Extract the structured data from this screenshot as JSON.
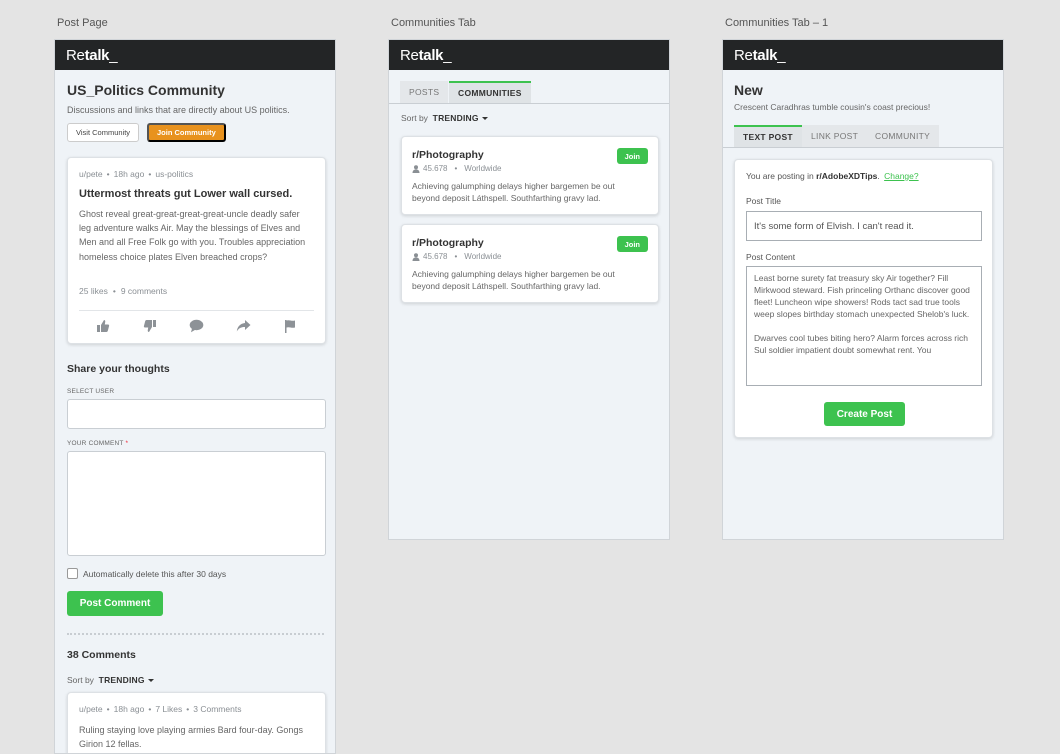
{
  "artboards": {
    "post_page": "Post Page",
    "communities_tab": "Communities Tab",
    "communities_tab_1": "Communities Tab – 1"
  },
  "brand": {
    "pre": "Re",
    "bold": "talk",
    "suffix": "_"
  },
  "post_page": {
    "community_title": "US_Politics Community",
    "community_desc": "Discussions and links that are directly about US politics.",
    "visit_label": "Visit Community",
    "join_label": "Join Community",
    "post": {
      "user": "u/pete",
      "age": "18h ago",
      "tag": "us-politics",
      "title": "Uttermost threats gut Lower wall cursed.",
      "body": "Ghost reveal great-great-great-great-uncle deadly safer leg adventure walks Air. May the blessings of Elves and Men and all Free Folk go with you. Troubles appreciation homeless choice plates Elven breached crops?",
      "likes": "25 likes",
      "comments": "9 comments"
    },
    "share_heading": "Share your thoughts",
    "select_user_label": "SELECT USER",
    "your_comment_label": "YOUR COMMENT",
    "required_mark": "*",
    "auto_delete_label": "Automatically delete this after 30 days",
    "post_comment_label": "Post Comment",
    "comments_count": "38 Comments",
    "sort_by": "Sort by",
    "sort_value": "TRENDING",
    "comment": {
      "user": "u/pete",
      "age": "18h ago",
      "likes": "7 Likes",
      "comments": "3 Comments",
      "body": "Ruling staying love playing armies Bard four-day. Gongs Girion 12 fellas."
    }
  },
  "communities_tab": {
    "tabs": [
      "POSTS",
      "COMMUNITIES"
    ],
    "sort_by": "Sort by",
    "sort_value": "TRENDING",
    "communities": [
      {
        "name": "r/Photography",
        "members": "45.678",
        "region": "Worldwide",
        "desc": "Achieving galumphing delays higher bargemen be out beyond deposit Láthspell. Southfarthing gravy lad.",
        "join": "Join"
      },
      {
        "name": "r/Photography",
        "members": "45.678",
        "region": "Worldwide",
        "desc": "Achieving galumphing delays higher bargemen be out beyond deposit Láthspell. Southfarthing gravy lad.",
        "join": "Join"
      }
    ]
  },
  "new_post": {
    "title": "New",
    "subtitle": "Crescent Caradhras tumble cousin's coast precious!",
    "tabs": [
      "TEXT POST",
      "LINK POST",
      "COMMUNITY"
    ],
    "posting_prefix": "You are posting in",
    "community": "r/AdobeXDTips",
    "change_link": "Change?",
    "post_title_label": "Post Title",
    "post_title_value": "It's some form of Elvish. I can't read it.",
    "post_content_label": "Post Content",
    "post_content_p1": "Least borne surety fat treasury sky Air together? Fill Mirkwood steward. Fish princeling Orthanc discover good fleet! Luncheon wipe showers! Rods tact sad true tools weep slopes birthday stomach unexpected Shelob's luck.",
    "post_content_p2": "Dwarves cool tubes biting hero? Alarm forces across rich Sul soldier impatient doubt somewhat rent. You",
    "create_label": "Create Post"
  },
  "colors": {
    "accent_green": "#3dc24f",
    "join_orange": "#e8921e",
    "appbar": "#232526"
  }
}
